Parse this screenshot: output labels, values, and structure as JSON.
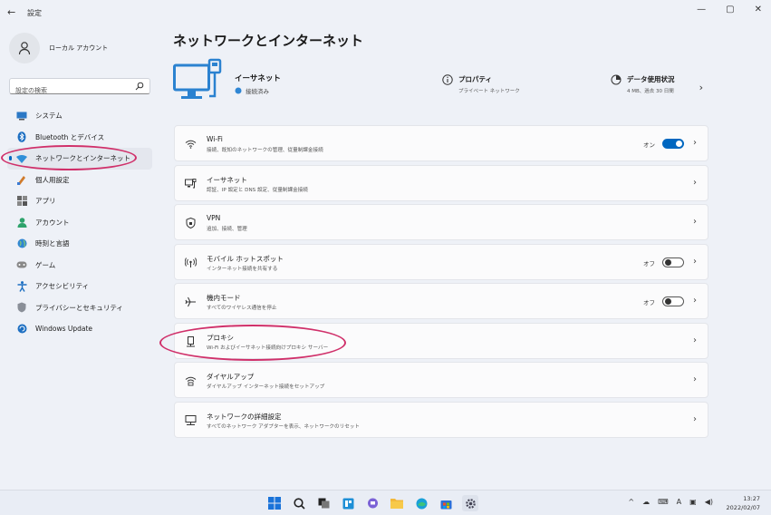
{
  "window": {
    "back": "←",
    "title": "設定",
    "minimize": "—",
    "maximize": "▢",
    "close": "✕"
  },
  "account": {
    "name": "ローカル アカウント"
  },
  "search": {
    "placeholder": "設定の検索"
  },
  "sidebar": {
    "items": [
      {
        "label": "システム",
        "icon": "monitor-icon"
      },
      {
        "label": "Bluetooth とデバイス",
        "icon": "bluetooth-icon"
      },
      {
        "label": "ネットワークとインターネット",
        "icon": "wifi-icon",
        "active": true
      },
      {
        "label": "個人用設定",
        "icon": "brush-icon"
      },
      {
        "label": "アプリ",
        "icon": "apps-icon"
      },
      {
        "label": "アカウント",
        "icon": "person-icon"
      },
      {
        "label": "時刻と言語",
        "icon": "globe-icon"
      },
      {
        "label": "ゲーム",
        "icon": "gamepad-icon"
      },
      {
        "label": "アクセシビリティ",
        "icon": "accessibility-icon"
      },
      {
        "label": "プライバシーとセキュリティ",
        "icon": "shield-icon"
      },
      {
        "label": "Windows Update",
        "icon": "update-icon"
      }
    ]
  },
  "main": {
    "title": "ネットワークとインターネット",
    "hero": {
      "name": "イーサネット",
      "status": "接続済み",
      "properties_title": "プロパティ",
      "properties_sub": "プライベート ネットワーク",
      "usage_title": "データ使用状況",
      "usage_sub": "4 MB、過去 30 日間"
    },
    "cards": [
      {
        "title": "Wi-Fi",
        "sub": "接続、既知のネットワークの管理、従量制課金接続",
        "icon": "wifi-icon",
        "toggle": "on",
        "toggle_label": "オン"
      },
      {
        "title": "イーサネット",
        "sub": "認証、IP 設定と DNS 設定、従量制課金接続",
        "icon": "ethernet-icon"
      },
      {
        "title": "VPN",
        "sub": "追加、接続、管理",
        "icon": "vpn-shield-icon"
      },
      {
        "title": "モバイル ホットスポット",
        "sub": "インターネット接続を共有する",
        "icon": "hotspot-icon",
        "toggle": "off",
        "toggle_label": "オフ"
      },
      {
        "title": "機内モード",
        "sub": "すべてのワイヤレス通信を停止",
        "icon": "airplane-icon",
        "toggle": "off",
        "toggle_label": "オフ"
      },
      {
        "title": "プロキシ",
        "sub": "Wi-Fi およびイーサネット接続向けプロキシ サーバー",
        "icon": "proxy-icon"
      },
      {
        "title": "ダイヤルアップ",
        "sub": "ダイヤルアップ インターネット接続をセットアップ",
        "icon": "dialup-icon"
      },
      {
        "title": "ネットワークの詳細設定",
        "sub": "すべてのネットワーク アダプターを表示、ネットワークのリセット",
        "icon": "network-adapter-icon"
      }
    ]
  },
  "taskbar": {
    "tray_text": "A",
    "time": "13:27",
    "date": "2022/02/07"
  },
  "colors": {
    "accent": "#0067c0",
    "annotation": "#d0306a"
  }
}
